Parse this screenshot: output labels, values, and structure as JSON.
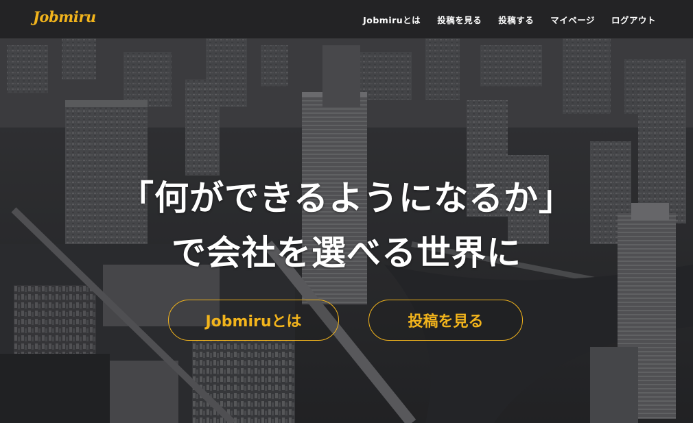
{
  "header": {
    "logo": "Jobmiru",
    "nav": [
      {
        "label": "Jobmiruとは"
      },
      {
        "label": "投稿を見る"
      },
      {
        "label": "投稿する"
      },
      {
        "label": "マイページ"
      },
      {
        "label": "ログアウト"
      }
    ]
  },
  "hero": {
    "headline_line1": "「何ができるようになるか」",
    "headline_line2": "で会社を選べる世界に",
    "buttons": [
      {
        "label": "Jobmiruとは"
      },
      {
        "label": "投稿を見る"
      }
    ]
  },
  "colors": {
    "accent": "#f2b41c",
    "navbar": "#232325",
    "text": "#ffffff"
  }
}
